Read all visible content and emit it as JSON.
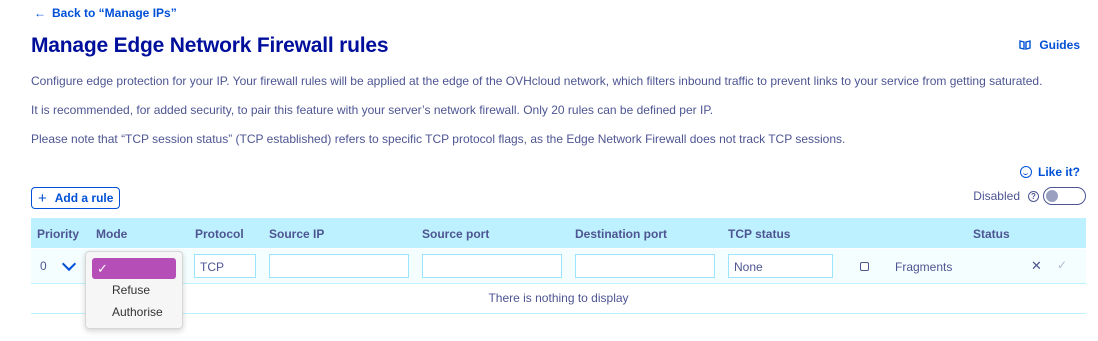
{
  "back_link": {
    "arrow": "←",
    "label": "Back to “Manage IPs”"
  },
  "title": "Manage Edge Network Firewall rules",
  "guides": {
    "label": "Guides",
    "icon": "book-icon"
  },
  "descriptions": [
    "Configure edge protection for your IP. Your firewall rules will be applied at the edge of the OVHcloud network, which filters inbound traffic to prevent links to your service from getting saturated.",
    "It is recommended, for added security, to pair this feature with your server’s network firewall. Only 20 rules can be defined per IP.",
    "Please note that “TCP session status” (TCP established) refers to specific TCP protocol flags, as the Edge Network Firewall does not track TCP sessions."
  ],
  "like_it": "Like it?",
  "add_rule": {
    "plus": "+",
    "label": "Add a rule"
  },
  "firewall_toggle": {
    "label": "Disabled",
    "help": "?",
    "enabled": false
  },
  "table": {
    "headers": {
      "priority": "Priority",
      "mode": "Mode",
      "protocol": "Protocol",
      "source_ip": "Source IP",
      "source_port": "Source port",
      "destination_port": "Destination port",
      "tcp_status": "TCP status",
      "status": "Status"
    },
    "edit_row": {
      "priority": "0",
      "protocol": "TCP",
      "source_ip": "",
      "source_port": "",
      "destination_port": "",
      "tcp_status": "None",
      "fragments_checked": false,
      "fragments_label": "Fragments",
      "cancel": "✕",
      "confirm": "✓"
    },
    "empty_message": "There is nothing to display"
  },
  "mode_dropdown": {
    "selected": "✓",
    "options": [
      "Refuse",
      "Authorise"
    ]
  },
  "colors": {
    "primary": "#0050d7",
    "title": "#000e9c",
    "header_bg": "#bef1ff",
    "dropdown_highlight": "#b64eb8"
  }
}
